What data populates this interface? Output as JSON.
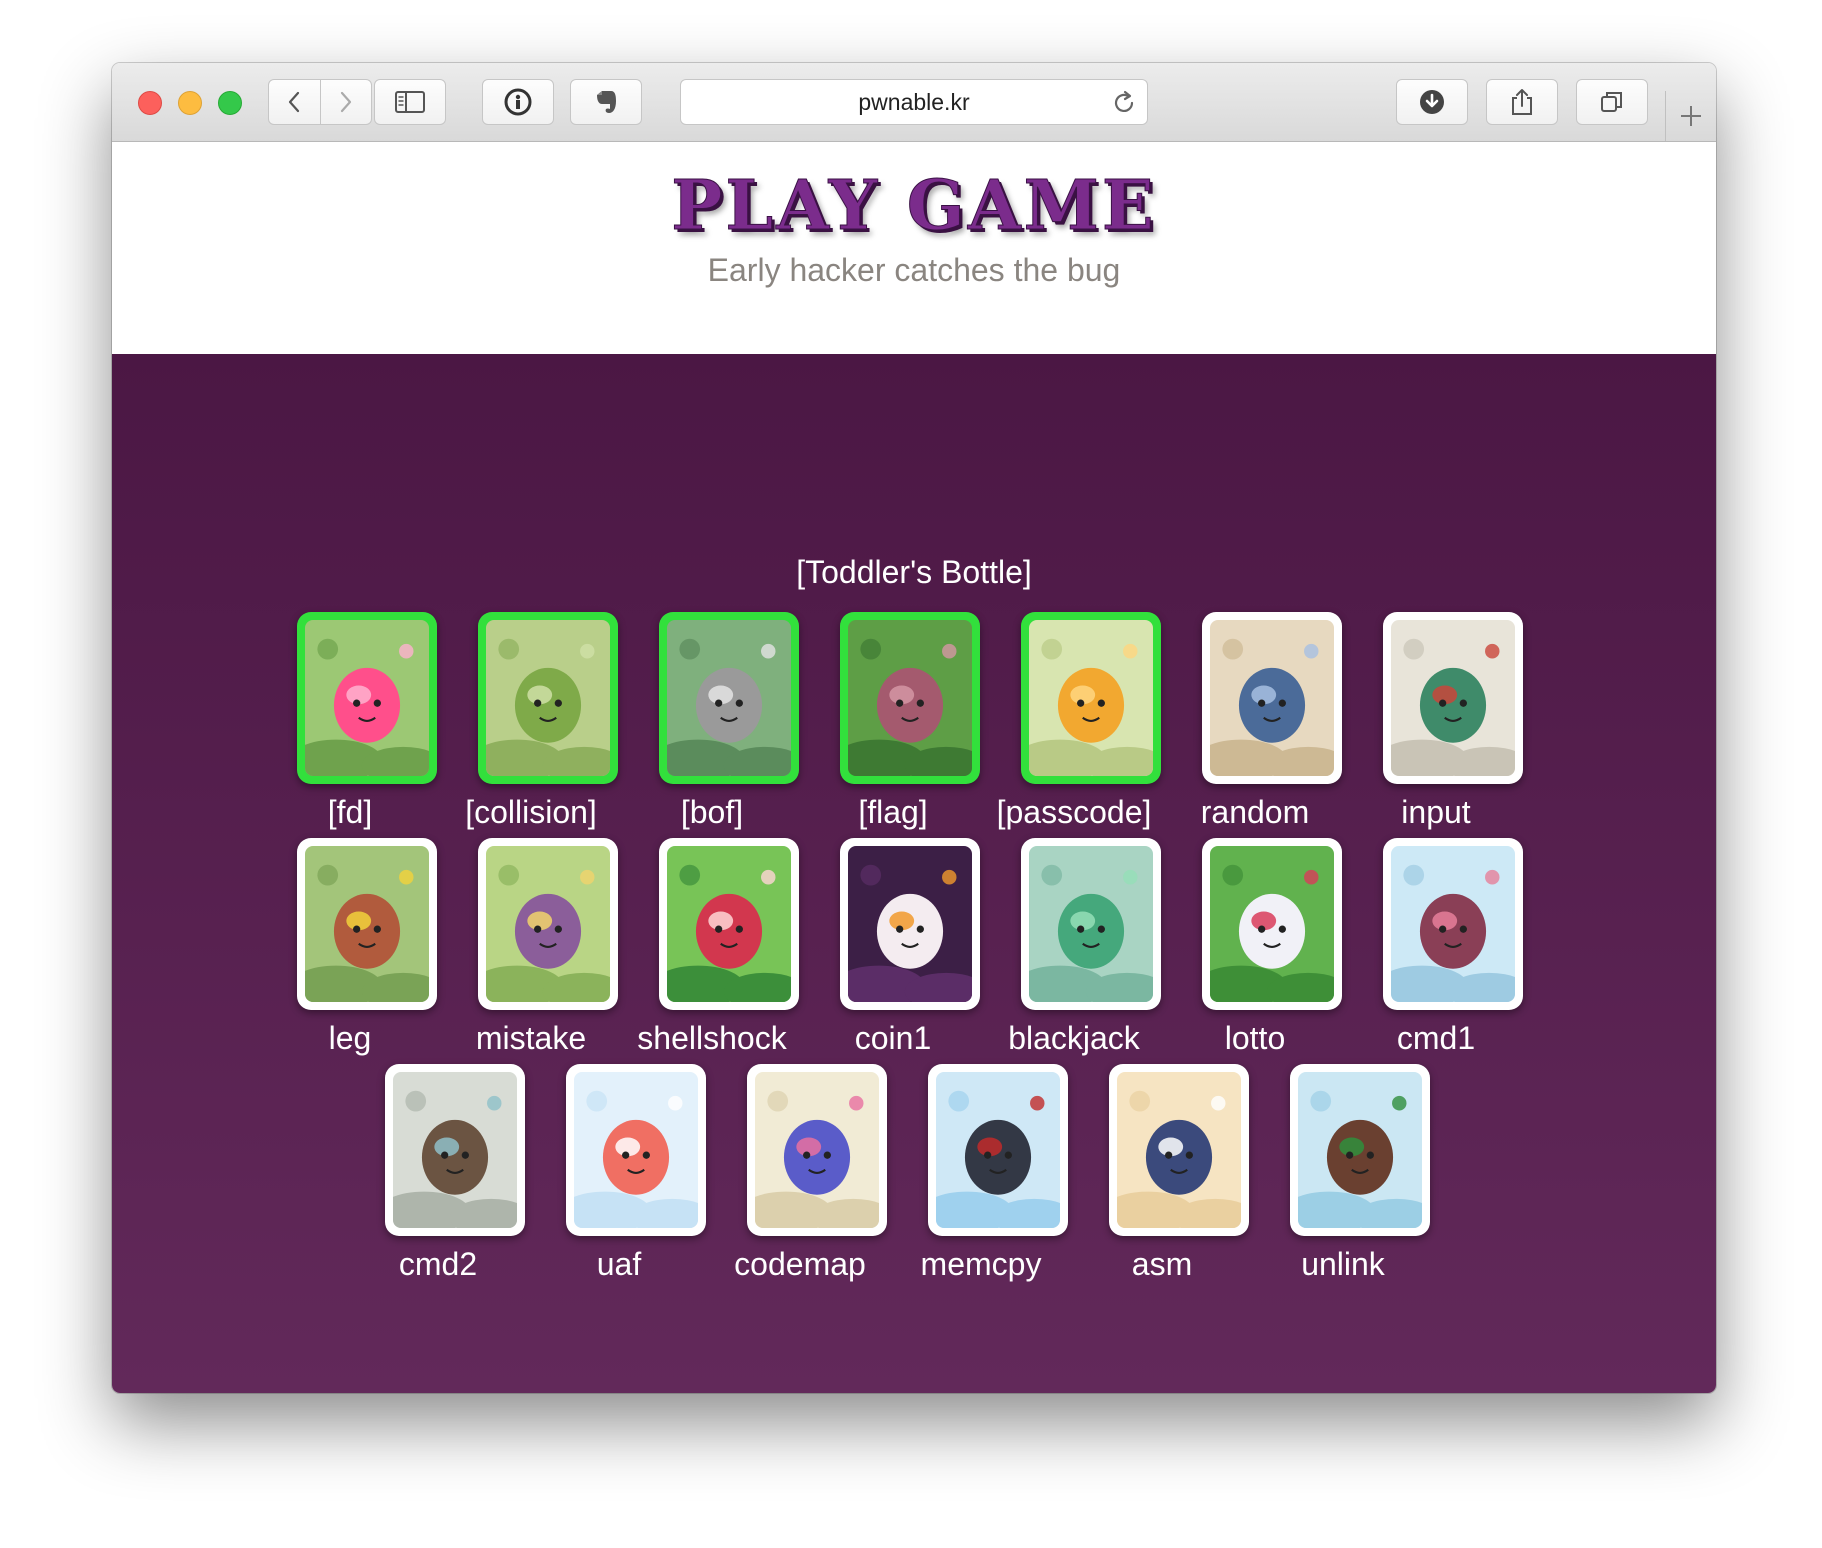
{
  "browser": {
    "url": "pwnable.kr",
    "icons": [
      "back-icon",
      "forward-icon",
      "sidebar-icon",
      "password-icon",
      "evernote-icon",
      "reload-icon",
      "download-icon",
      "share-icon",
      "tabs-icon",
      "new-tab-icon"
    ]
  },
  "header": {
    "title": "PLAY GAME",
    "tagline": "Early hacker catches the bug"
  },
  "section": {
    "title": "[Toddler's Bottle]"
  },
  "colors": {
    "accent": "#7b2c8c",
    "background": "#4b1744",
    "solved_border": "#32e03c"
  },
  "challenges": [
    {
      "label": "[fd]",
      "solved": true,
      "art": "pink-slime"
    },
    {
      "label": "[collision]",
      "solved": true,
      "art": "caterpillars"
    },
    {
      "label": "[bof]",
      "solved": true,
      "art": "raccoon"
    },
    {
      "label": "[flag]",
      "solved": true,
      "art": "cocoon"
    },
    {
      "label": "[passcode]",
      "solved": true,
      "art": "bird"
    },
    {
      "label": "random",
      "solved": false,
      "art": "wolf"
    },
    {
      "label": "input",
      "solved": false,
      "art": "bug-boxer"
    },
    {
      "label": "leg",
      "solved": false,
      "art": "bear"
    },
    {
      "label": "mistake",
      "solved": false,
      "art": "monkey"
    },
    {
      "label": "shellshock",
      "solved": false,
      "art": "plant-mouth"
    },
    {
      "label": "coin1",
      "solved": false,
      "art": "ghost"
    },
    {
      "label": "blackjack",
      "solved": false,
      "art": "lizard"
    },
    {
      "label": "lotto",
      "solved": false,
      "art": "rabbit"
    },
    {
      "label": "cmd1",
      "solved": false,
      "art": "girl-mushroom"
    },
    {
      "label": "cmd2",
      "solved": false,
      "art": "shell-creature"
    },
    {
      "label": "uaf",
      "solved": false,
      "art": "slime-cloud"
    },
    {
      "label": "codemap",
      "solved": false,
      "art": "sleeping-creatures"
    },
    {
      "label": "memcpy",
      "solved": false,
      "art": "cat-cape"
    },
    {
      "label": "asm",
      "solved": false,
      "art": "penguin"
    },
    {
      "label": "unlink",
      "solved": false,
      "art": "beetle"
    }
  ]
}
